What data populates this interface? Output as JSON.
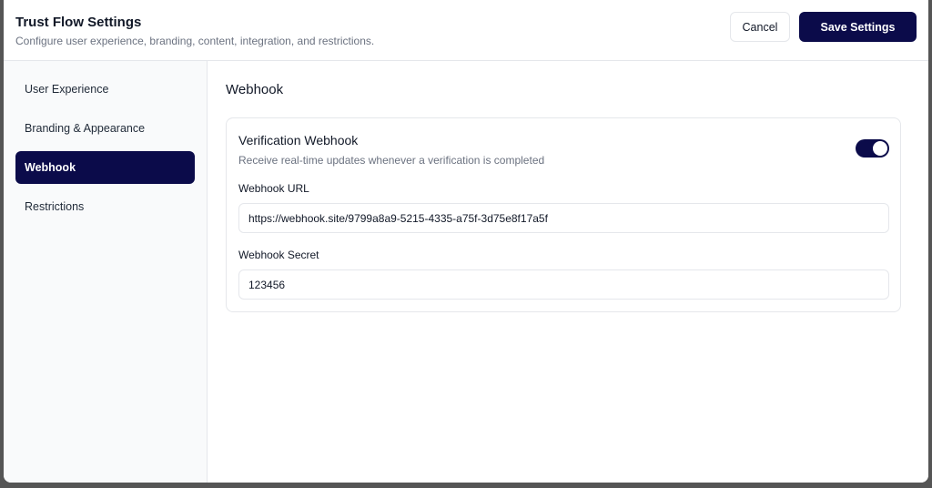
{
  "header": {
    "title": "Trust Flow Settings",
    "subtitle": "Configure user experience, branding, content, integration, and restrictions.",
    "cancel_label": "Cancel",
    "save_label": "Save Settings"
  },
  "sidebar": {
    "items": [
      {
        "label": "User Experience",
        "active": false
      },
      {
        "label": "Branding & Appearance",
        "active": false
      },
      {
        "label": "Webhook",
        "active": true
      },
      {
        "label": "Restrictions",
        "active": false
      }
    ]
  },
  "main": {
    "section_title": "Webhook",
    "card": {
      "title": "Verification Webhook",
      "description": "Receive real-time updates whenever a verification is completed",
      "toggle_on": true,
      "url_label": "Webhook URL",
      "url_value": "https://webhook.site/9799a8a9-5215-4335-a75f-3d75e8f17a5f",
      "secret_label": "Webhook Secret",
      "secret_value": "123456"
    }
  },
  "colors": {
    "accent": "#0b0b4a",
    "border": "#e5e7eb",
    "sidebar_bg": "#f9fafb"
  }
}
